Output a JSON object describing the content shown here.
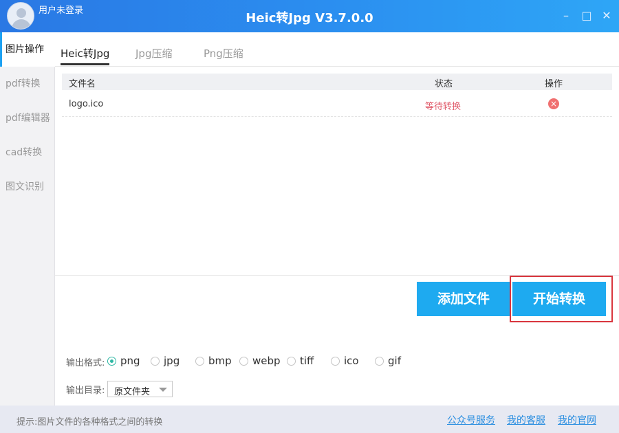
{
  "header": {
    "user_status": "用户未登录",
    "title": "Heic转Jpg V3.7.0.0",
    "min_icon": "minimize-icon",
    "max_icon": "maximize-icon",
    "close_icon": "close-icon"
  },
  "sidebar": {
    "items": [
      {
        "label": "图片操作",
        "active": true
      },
      {
        "label": "pdf转换"
      },
      {
        "label": "pdf编辑器"
      },
      {
        "label": "cad转换"
      },
      {
        "label": "图文识别"
      }
    ]
  },
  "tabs": [
    {
      "label": "Heic转Jpg",
      "active": true
    },
    {
      "label": "Jpg压缩"
    },
    {
      "label": "Png压缩"
    }
  ],
  "table": {
    "headers": {
      "filename": "文件名",
      "status": "状态",
      "action": "操作"
    },
    "rows": [
      {
        "filename": "logo.ico",
        "status": "等待转换",
        "action_icon": "delete-icon"
      }
    ]
  },
  "buttons": {
    "add": "添加文件",
    "start": "开始转换"
  },
  "output": {
    "format_label": "输出格式:",
    "formats": [
      "png",
      "jpg",
      "bmp",
      "webp",
      "tiff",
      "ico",
      "gif"
    ],
    "selected_format": "png",
    "dir_label": "输出目录:",
    "dir_value": "原文件夹"
  },
  "footer": {
    "tip": "提示:图片文件的各种格式之间的转换",
    "links": [
      "公众号服务",
      "我的客服",
      "我的官网"
    ]
  },
  "colors": {
    "accent": "#1eaaf0",
    "status": "#e05b6b",
    "highlight": "#d9363e"
  }
}
